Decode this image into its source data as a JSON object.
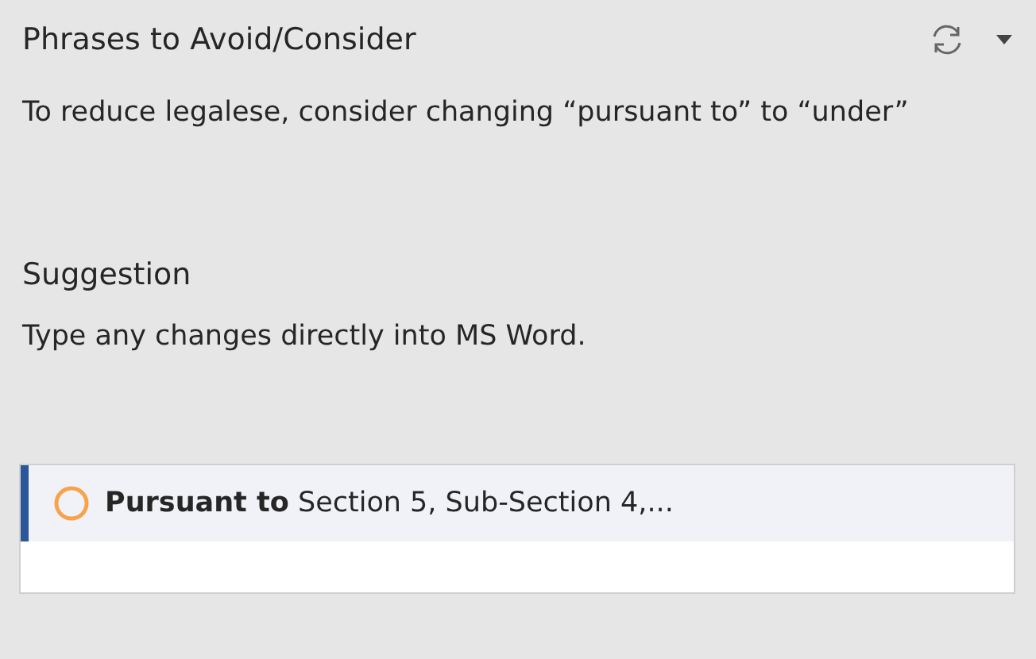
{
  "header": {
    "title": "Phrases to Avoid/Consider"
  },
  "message": "To reduce legalese, consider changing “pursuant to” to “under”",
  "suggestion": {
    "heading": "Suggestion",
    "text": "Type any changes directly into MS Word."
  },
  "results": [
    {
      "text": "**Pursuant to** Section 5, Sub-Section 4,...",
      "selected": true
    }
  ]
}
